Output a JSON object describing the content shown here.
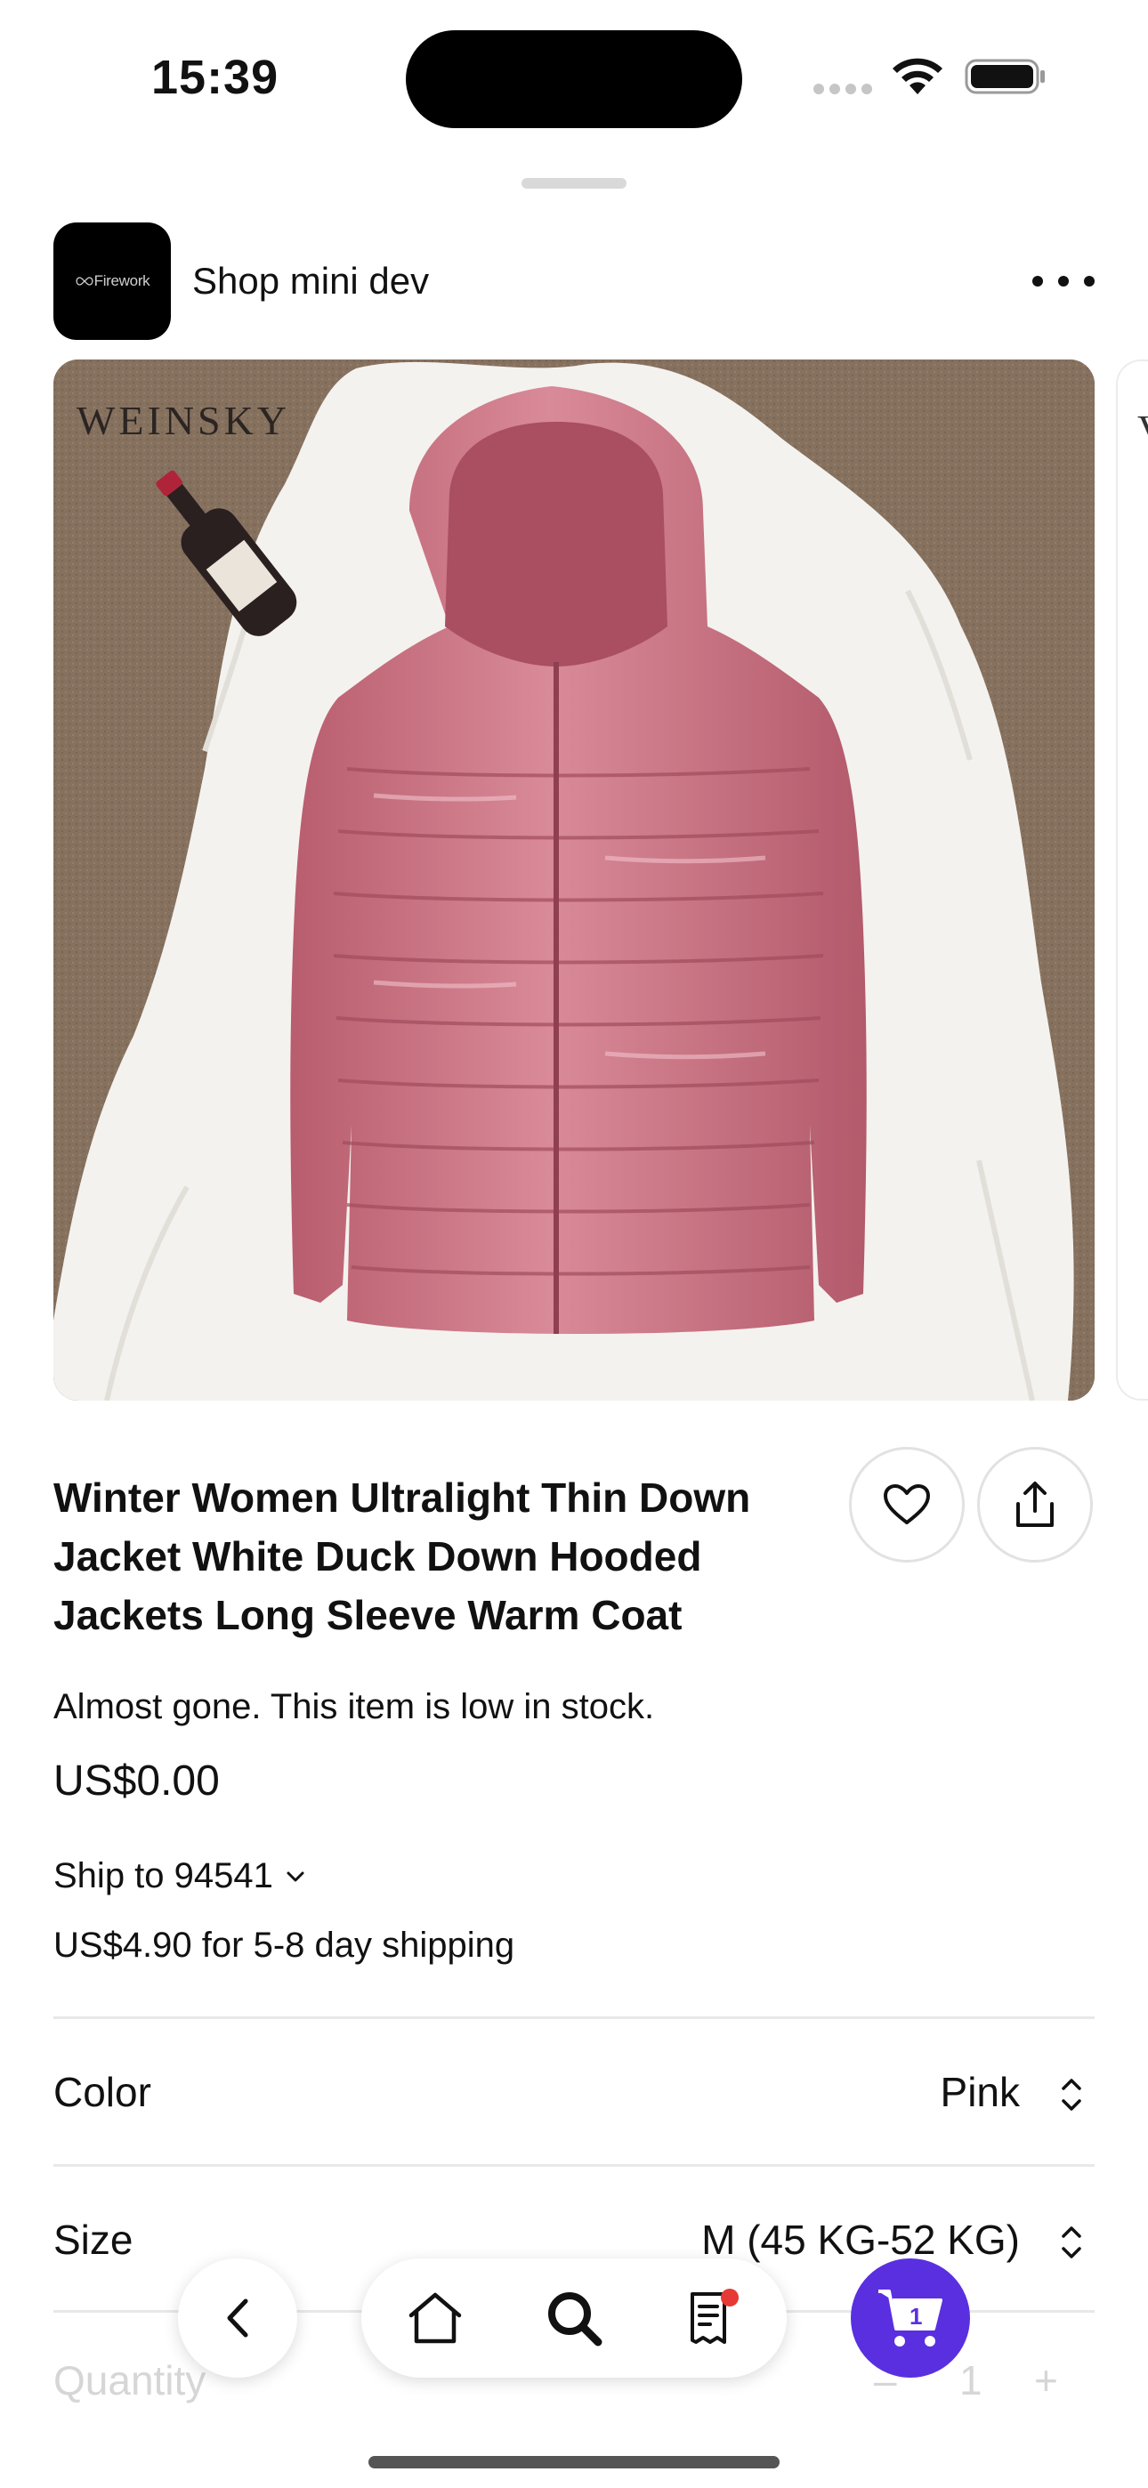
{
  "status_bar": {
    "time": "15:39"
  },
  "shop": {
    "logo_text": "Firework",
    "name": "Shop mini dev"
  },
  "product": {
    "image_brand_text": "WEINSKY",
    "title": "Winter Women Ultralight Thin Down Jacket White Duck Down Hooded Jackets Long Sleeve Warm Coat",
    "stock_message": "Almost gone. This item is low in stock.",
    "price": "US$0.00",
    "ship_to": "Ship to 94541",
    "shipping": "US$4.90 for 5-8 day shipping"
  },
  "options": {
    "color_label": "Color",
    "color_value": "Pink",
    "size_label": "Size",
    "size_value": "M (45 KG-52 KG)",
    "quantity_label": "Quantity",
    "quantity_minus": "–",
    "quantity_value": "1",
    "quantity_plus": "+"
  },
  "bottom_nav": {
    "cart_count": "1",
    "orders_has_badge": true
  },
  "colors": {
    "accent": "#5a2fe0",
    "badge": "#e53935",
    "jacket": "#c9707f"
  },
  "icons": [
    "wifi-icon",
    "battery-icon",
    "more-icon",
    "heart-icon",
    "share-icon",
    "chevron-down-icon",
    "sort-icon",
    "back-icon",
    "home-icon",
    "search-icon",
    "receipt-icon",
    "cart-icon"
  ]
}
